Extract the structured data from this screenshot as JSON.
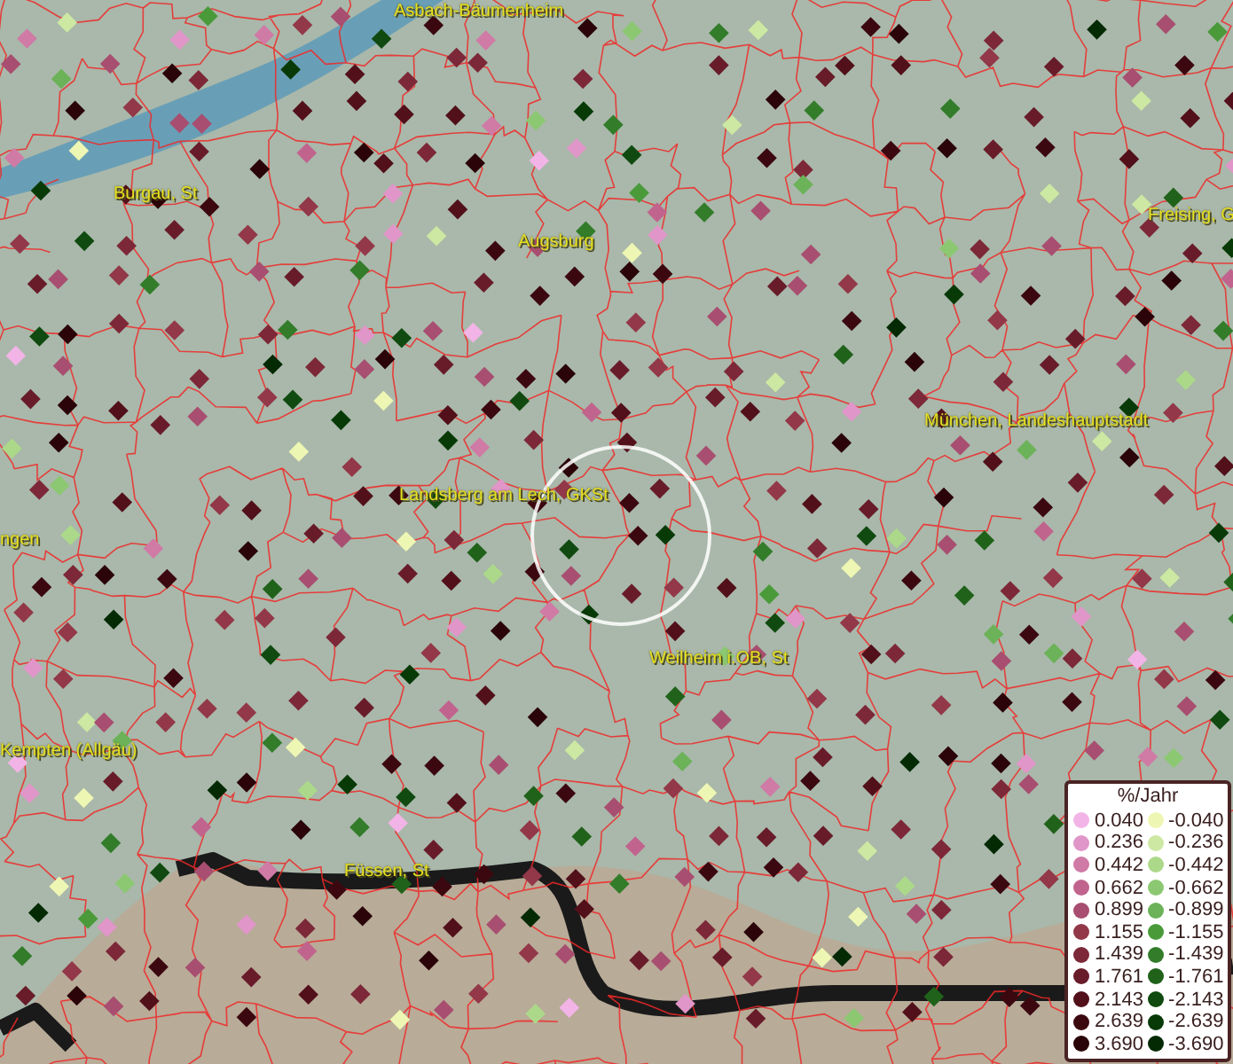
{
  "map": {
    "place_labels": [
      {
        "text": "Asbach-Bäumenheim"
      },
      {
        "text": "Burgau, St"
      },
      {
        "text": "Augsburg"
      },
      {
        "text": "Freising, G"
      },
      {
        "text": "München, Landeshauptstadt"
      },
      {
        "text": "Landsberg am Lech, GKSt"
      },
      {
        "text": "ngen"
      },
      {
        "text": "Weilheim i.OB, St"
      },
      {
        "text": "Kempten (Allgäu)"
      },
      {
        "text": "Füssen, St"
      }
    ]
  },
  "legend": {
    "title": "%/Jahr",
    "columns": [
      [
        {
          "label": "0.040",
          "color": "#f2b4e6"
        },
        {
          "label": "0.236",
          "color": "#e096c8"
        },
        {
          "label": "0.442",
          "color": "#d07aa6"
        },
        {
          "label": "0.662",
          "color": "#c0648e"
        },
        {
          "label": "0.899",
          "color": "#a84e70"
        },
        {
          "label": "1.155",
          "color": "#923848"
        },
        {
          "label": "1.439",
          "color": "#7c2838"
        },
        {
          "label": "1.761",
          "color": "#681c2a"
        },
        {
          "label": "2.143",
          "color": "#52101a"
        },
        {
          "label": "2.639",
          "color": "#3c0810"
        },
        {
          "label": "3.690",
          "color": "#2a0408"
        }
      ],
      [
        {
          "label": "-0.040",
          "color": "#eef6b4"
        },
        {
          "label": "-0.236",
          "color": "#cce8a2"
        },
        {
          "label": "-0.442",
          "color": "#acd88a"
        },
        {
          "label": "-0.662",
          "color": "#8cc872"
        },
        {
          "label": "-0.899",
          "color": "#6cb258"
        },
        {
          "label": "-1.155",
          "color": "#4a9a3a"
        },
        {
          "label": "-1.439",
          "color": "#327c2a"
        },
        {
          "label": "-1.761",
          "color": "#20621a"
        },
        {
          "label": "-2.143",
          "color": "#104a10"
        },
        {
          "label": "-2.639",
          "color": "#083a08"
        },
        {
          "label": "-3.690",
          "color": "#042a04"
        }
      ]
    ]
  }
}
